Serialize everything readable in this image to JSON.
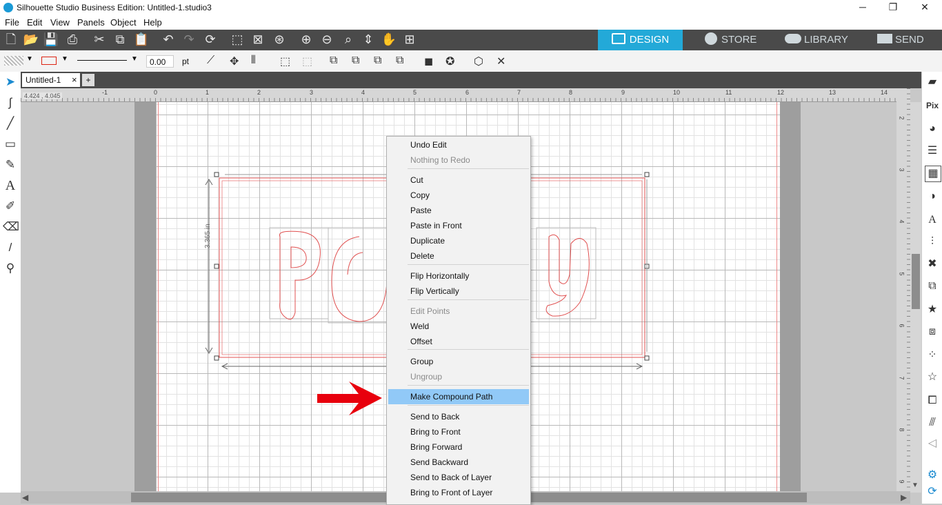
{
  "window": {
    "title": "Silhouette Studio Business Edition: Untitled-1.studio3"
  },
  "menu": [
    "File",
    "Edit",
    "View",
    "Panels",
    "Object",
    "Help"
  ],
  "nav_tabs": [
    "DESIGN",
    "STORE",
    "LIBRARY",
    "SEND"
  ],
  "toolbar2": {
    "line_width": "0.00",
    "unit": "pt"
  },
  "document_tab": {
    "name": "Untitled-1",
    "close": "×",
    "add": "+"
  },
  "ruler": {
    "readout": "4.424 , 4.045",
    "h_marks": [
      "-1",
      "0",
      "1",
      "2",
      "3",
      "4",
      "5",
      "6",
      "7",
      "8",
      "9",
      "10",
      "11",
      "12",
      "13",
      "14"
    ],
    "v_marks": [
      "2",
      "3",
      "4",
      "5",
      "6",
      "7",
      "8",
      "9"
    ]
  },
  "selection": {
    "height_label": "3.365 in"
  },
  "design_text": "Polly",
  "context_menu": {
    "items": [
      {
        "label": "Undo Edit",
        "enabled": true
      },
      {
        "label": "Nothing to Redo",
        "enabled": false
      },
      {
        "label": "Cut",
        "enabled": true
      },
      {
        "label": "Copy",
        "enabled": true
      },
      {
        "label": "Paste",
        "enabled": true
      },
      {
        "label": "Paste in Front",
        "enabled": true
      },
      {
        "label": "Duplicate",
        "enabled": true
      },
      {
        "label": "Delete",
        "enabled": true
      },
      {
        "label": "Flip Horizontally",
        "enabled": true
      },
      {
        "label": "Flip Vertically",
        "enabled": true
      },
      {
        "label": "Edit Points",
        "enabled": false
      },
      {
        "label": "Weld",
        "enabled": true
      },
      {
        "label": "Offset",
        "enabled": true
      },
      {
        "label": "Group",
        "enabled": true
      },
      {
        "label": "Ungroup",
        "enabled": false
      },
      {
        "label": "Make Compound Path",
        "enabled": true,
        "highlighted": true
      },
      {
        "label": "Send to Back",
        "enabled": true
      },
      {
        "label": "Bring to Front",
        "enabled": true
      },
      {
        "label": "Bring Forward",
        "enabled": true
      },
      {
        "label": "Send Backward",
        "enabled": true
      },
      {
        "label": "Send to Back of Layer",
        "enabled": true
      },
      {
        "label": "Bring to Front of Layer",
        "enabled": true
      }
    ]
  },
  "colors": {
    "accent": "#23a9d8",
    "highlight": "#91c9f7",
    "arrow": "#e8000d",
    "cut_line": "#e05050"
  }
}
